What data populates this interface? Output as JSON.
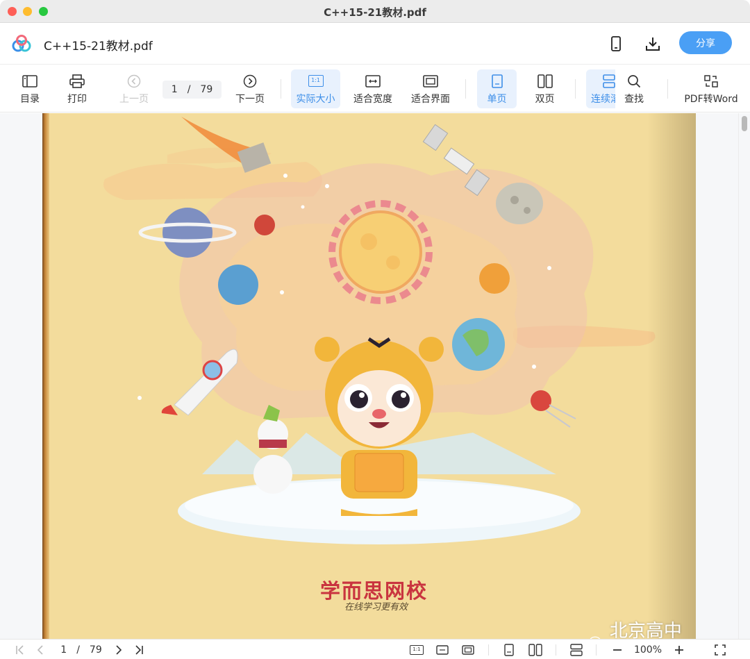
{
  "window": {
    "title": "C++15-21教材.pdf"
  },
  "header": {
    "doc_title": "C++15-21教材.pdf",
    "share_label": "分享"
  },
  "toolbar": {
    "toc": "目录",
    "print": "打印",
    "prev": "上一页",
    "page_current": "1",
    "page_sep": "/",
    "page_total": "79",
    "next": "下一页",
    "actual_size": "实际大小",
    "actual_size_glyph": "1:1",
    "fit_width": "适合宽度",
    "fit_page": "适合界面",
    "single": "单页",
    "double": "双页",
    "continuous": "连续滚",
    "find": "查找",
    "pdf_to_word": "PDF转Word"
  },
  "document": {
    "publisher": "学而思网校",
    "slogan": "在线学习更有效",
    "watermark": "北京高中学习资料"
  },
  "bottombar": {
    "page_current": "1",
    "page_sep": "/",
    "page_total": "79",
    "actual_size_glyph": "1:1",
    "zoom": "100%"
  },
  "colors": {
    "accent": "#4a9ff5",
    "active_bg": "#e8f1fd",
    "page_bg": "#f3dc9c"
  }
}
